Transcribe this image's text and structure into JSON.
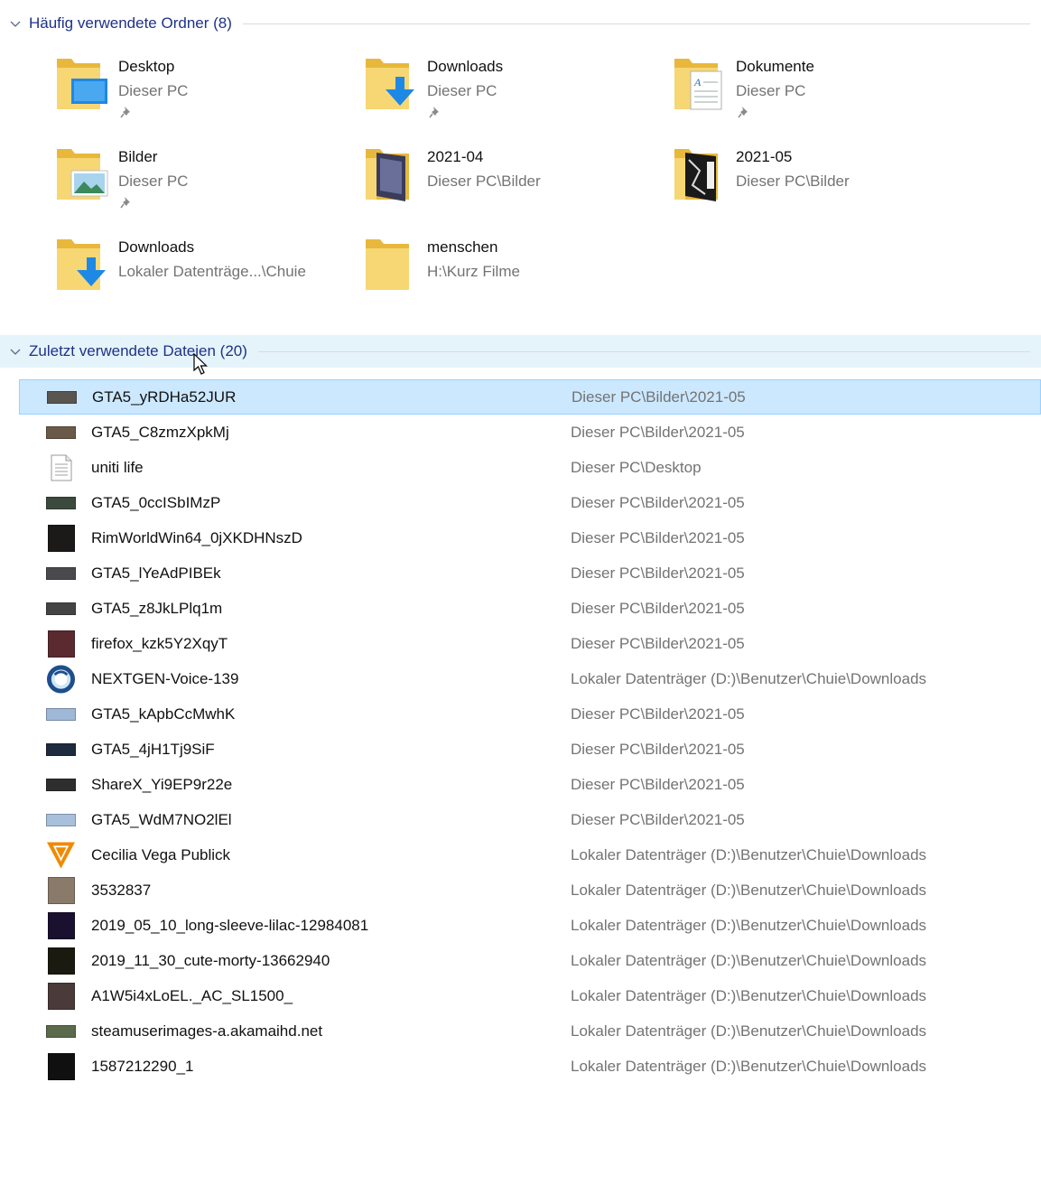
{
  "frequent": {
    "title": "Häufig verwendete Ordner (8)",
    "folders": [
      {
        "name": "Desktop",
        "path": "Dieser PC",
        "pinned": true,
        "icon": "desktop-folder-icon"
      },
      {
        "name": "Downloads",
        "path": "Dieser PC",
        "pinned": true,
        "icon": "downloads-folder-icon"
      },
      {
        "name": "Dokumente",
        "path": "Dieser PC",
        "pinned": true,
        "icon": "documents-folder-icon"
      },
      {
        "name": "Bilder",
        "path": "Dieser PC",
        "pinned": true,
        "icon": "pictures-folder-icon"
      },
      {
        "name": "2021-04",
        "path": "Dieser PC\\Bilder",
        "pinned": false,
        "icon": "image-folder-icon"
      },
      {
        "name": "2021-05",
        "path": "Dieser PC\\Bilder",
        "pinned": false,
        "icon": "image-folder-icon"
      },
      {
        "name": "Downloads",
        "path": "Lokaler Datenträge...\\Chuie",
        "pinned": false,
        "icon": "downloads-folder-icon"
      },
      {
        "name": "menschen",
        "path": "H:\\Kurz Filme",
        "pinned": false,
        "icon": "folder-icon"
      }
    ]
  },
  "recent": {
    "title": "Zuletzt verwendete Dateien (20)",
    "files": [
      {
        "name": "GTA5_yRDHa52JUR",
        "path": "Dieser PC\\Bilder\\2021-05",
        "thumb": "screenshot-thumbnail",
        "color": "#5a5550"
      },
      {
        "name": "GTA5_C8zmzXpkMj",
        "path": "Dieser PC\\Bilder\\2021-05",
        "thumb": "screenshot-thumbnail",
        "color": "#6b5a48"
      },
      {
        "name": "uniti life",
        "path": "Dieser PC\\Desktop",
        "thumb": "text-document-icon",
        "color": "#ffffff"
      },
      {
        "name": "GTA5_0ccISbIMzP",
        "path": "Dieser PC\\Bilder\\2021-05",
        "thumb": "screenshot-thumbnail",
        "color": "#3c4a3e"
      },
      {
        "name": "RimWorldWin64_0jXKDHNszD",
        "path": "Dieser PC\\Bilder\\2021-05",
        "thumb": "screenshot-thumbnail",
        "color": "#1c1a18"
      },
      {
        "name": "GTA5_lYeAdPIBEk",
        "path": "Dieser PC\\Bilder\\2021-05",
        "thumb": "screenshot-thumbnail",
        "color": "#4a4a4e"
      },
      {
        "name": "GTA5_z8JkLPlq1m",
        "path": "Dieser PC\\Bilder\\2021-05",
        "thumb": "screenshot-thumbnail",
        "color": "#444444"
      },
      {
        "name": "firefox_kzk5Y2XqyT",
        "path": "Dieser PC\\Bilder\\2021-05",
        "thumb": "screenshot-thumbnail",
        "color": "#5a2a30"
      },
      {
        "name": "NEXTGEN-Voice-139",
        "path": "Lokaler Datenträger (D:)\\Benutzer\\Chuie\\Downloads",
        "thumb": "audio-file-icon",
        "color": "#1e4e8c"
      },
      {
        "name": "GTA5_kApbCcMwhK",
        "path": "Dieser PC\\Bilder\\2021-05",
        "thumb": "screenshot-thumbnail",
        "color": "#9fb8d8"
      },
      {
        "name": "GTA5_4jH1Tj9SiF",
        "path": "Dieser PC\\Bilder\\2021-05",
        "thumb": "screenshot-thumbnail",
        "color": "#1e2a3e"
      },
      {
        "name": "ShareX_Yi9EP9r22e",
        "path": "Dieser PC\\Bilder\\2021-05",
        "thumb": "screenshot-thumbnail",
        "color": "#2e2e2e"
      },
      {
        "name": "GTA5_WdM7NO2lEl",
        "path": "Dieser PC\\Bilder\\2021-05",
        "thumb": "screenshot-thumbnail",
        "color": "#a8c0dc"
      },
      {
        "name": "Cecilia Vega Publick",
        "path": "Lokaler Datenträger (D:)\\Benutzer\\Chuie\\Downloads",
        "thumb": "vlc-media-icon",
        "color": "#f08a00"
      },
      {
        "name": "3532837",
        "path": "Lokaler Datenträger (D:)\\Benutzer\\Chuie\\Downloads",
        "thumb": "image-thumbnail",
        "color": "#8a7a6a"
      },
      {
        "name": "2019_05_10_long-sleeve-lilac-12984081",
        "path": "Lokaler Datenträger (D:)\\Benutzer\\Chuie\\Downloads",
        "thumb": "image-thumbnail",
        "color": "#1a1030"
      },
      {
        "name": "2019_11_30_cute-morty-13662940",
        "path": "Lokaler Datenträger (D:)\\Benutzer\\Chuie\\Downloads",
        "thumb": "image-thumbnail",
        "color": "#1a1a10"
      },
      {
        "name": "A1W5i4xLoEL._AC_SL1500_",
        "path": "Lokaler Datenträger (D:)\\Benutzer\\Chuie\\Downloads",
        "thumb": "image-thumbnail",
        "color": "#4a3a3a"
      },
      {
        "name": "steamuserimages-a.akamaihd.net",
        "path": "Lokaler Datenträger (D:)\\Benutzer\\Chuie\\Downloads",
        "thumb": "image-thumbnail",
        "color": "#5a6a4a"
      },
      {
        "name": "1587212290_1",
        "path": "Lokaler Datenträger (D:)\\Benutzer\\Chuie\\Downloads",
        "thumb": "image-thumbnail",
        "color": "#101010"
      }
    ]
  }
}
